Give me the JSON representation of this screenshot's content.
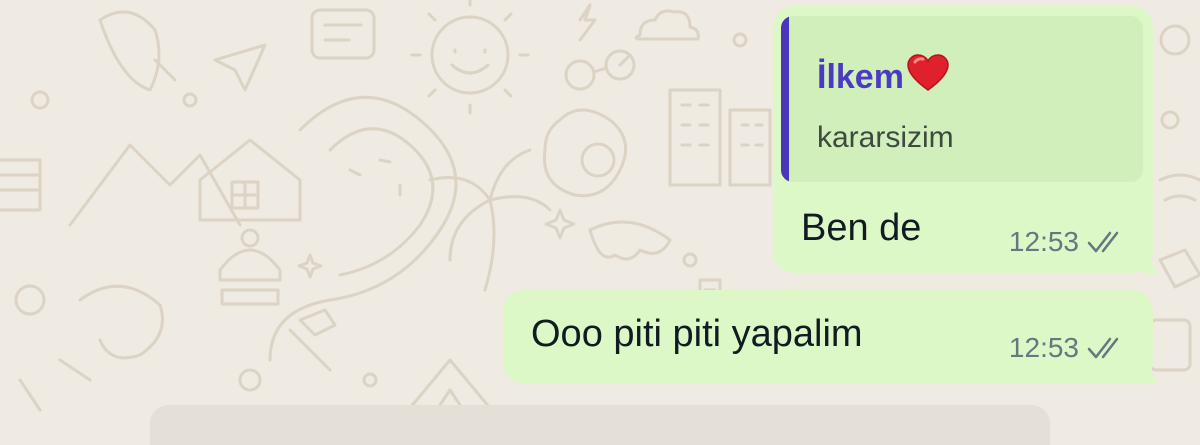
{
  "chat": {
    "messages": [
      {
        "direction": "outgoing",
        "quoted": {
          "author": "İlkem",
          "author_emoji": "heart-icon",
          "text": "kararsizim"
        },
        "text": "Ben de",
        "time": "12:53",
        "status": "read-double-check"
      },
      {
        "direction": "outgoing",
        "text": "Ooo piti piti yapalim",
        "time": "12:53",
        "status": "read-double-check"
      }
    ]
  },
  "colors": {
    "background": "#efeae2",
    "outgoing_bubble": "#dbf8c6",
    "quote_background": "#d1efbb",
    "quote_accent": "#4b35b8",
    "quote_author": "#4b3bc4",
    "timestamp": "#667781"
  }
}
